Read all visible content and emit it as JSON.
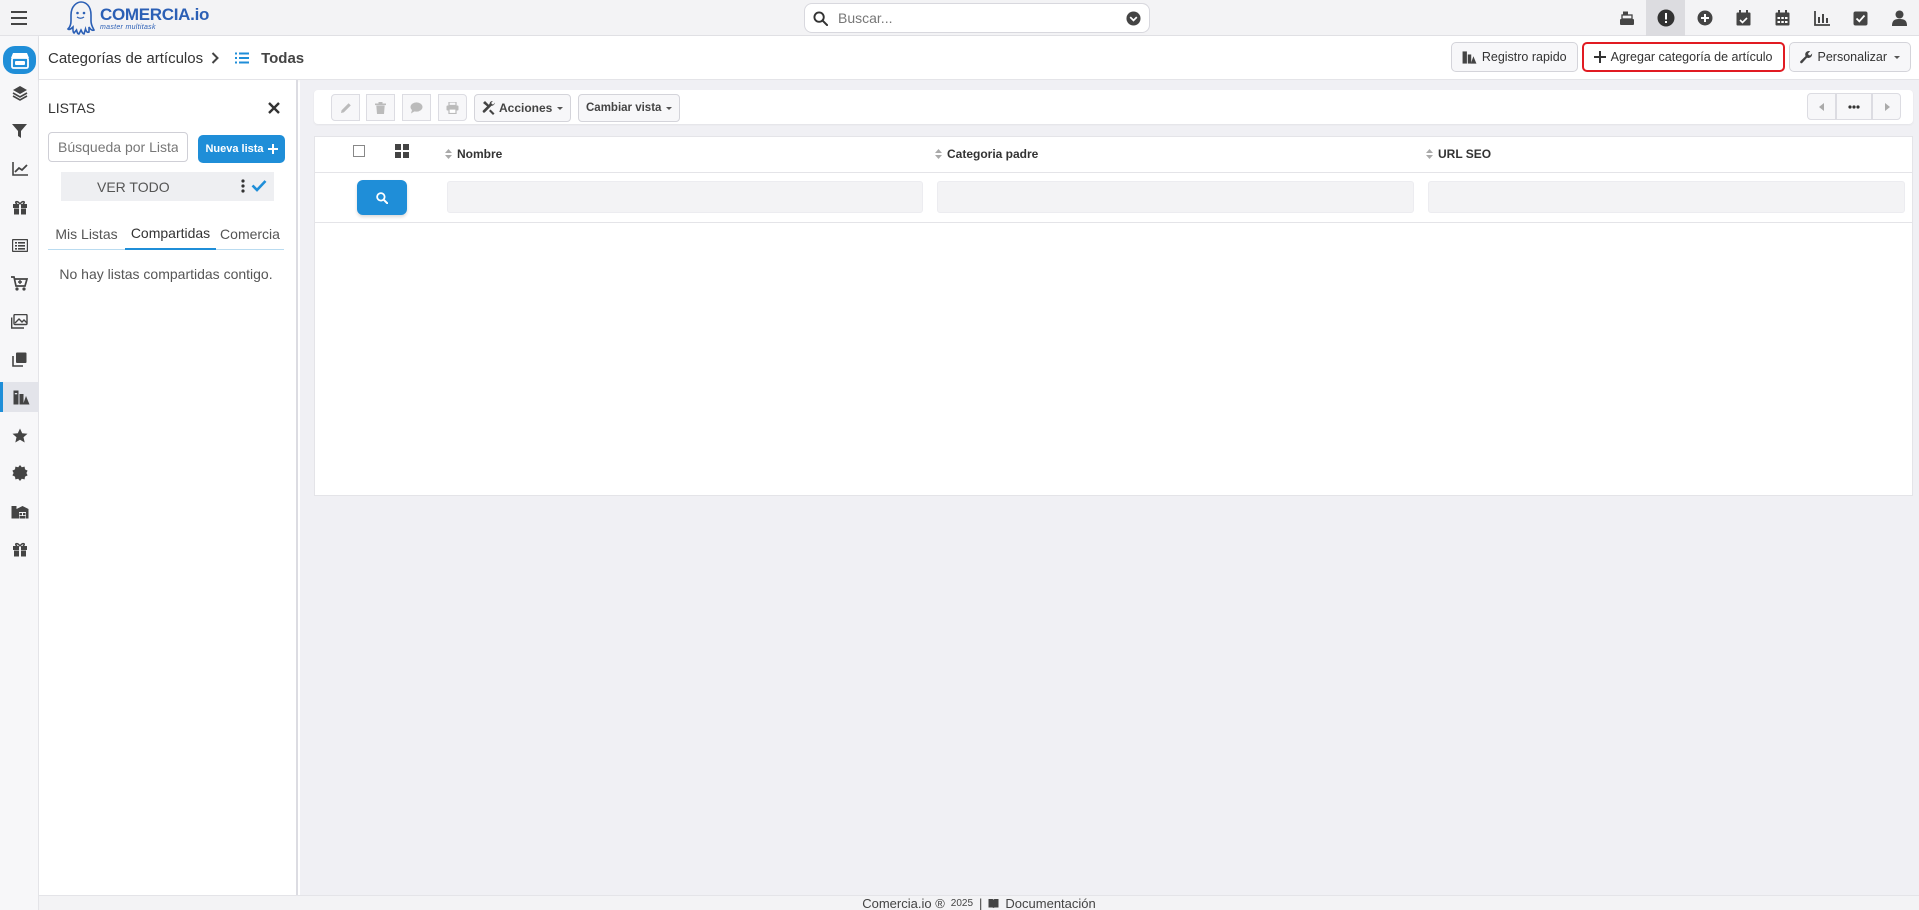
{
  "header": {
    "brand_name": "COMERCIA",
    "brand_suffix": ".io",
    "brand_tagline": "master multitask",
    "search_placeholder": "Buscar...",
    "icons": [
      "cash-register-icon",
      "alert-icon",
      "plus-circle-icon",
      "calendar-check-icon",
      "calendar-icon",
      "chart-icon",
      "checkbox-icon",
      "user-icon"
    ]
  },
  "sidebar": {
    "items": [
      "store-icon",
      "layers-icon",
      "filter-icon",
      "chart-line-icon",
      "gift-icon",
      "list-icon",
      "cart-icon",
      "images-icon",
      "copy-icon",
      "categories-icon",
      "star-icon",
      "badge-icon",
      "warehouse-icon",
      "gift-box-icon"
    ],
    "active": "categories-icon"
  },
  "breadcrumb": {
    "section": "Categorías de artículos",
    "current": "Todas"
  },
  "actions": {
    "quick_register": "Registro rapido",
    "add_category": "Agregar categoría de artículo",
    "customize": "Personalizar"
  },
  "lists_panel": {
    "title": "LISTAS",
    "search_placeholder": "Búsqueda por Lista",
    "new_list": "Nueva lista",
    "view_all": "VER TODO",
    "tabs": [
      "Mis Listas",
      "Compartidas",
      "Comercia"
    ],
    "active_tab": "Compartidas",
    "empty_message": "No hay listas compartidas contigo."
  },
  "toolbar": {
    "actions_label": "Acciones",
    "change_view_label": "Cambiar vista"
  },
  "grid": {
    "columns": [
      "Nombre",
      "Categoria padre",
      "URL SEO"
    ]
  },
  "footer": {
    "copyright": "Comercia.io ®",
    "year": "2025",
    "separator": "|",
    "docs": "Documentación"
  },
  "colors": {
    "accent": "#1f8ed8",
    "highlight_border": "#e11b22",
    "brand": "#2b5fb5"
  }
}
